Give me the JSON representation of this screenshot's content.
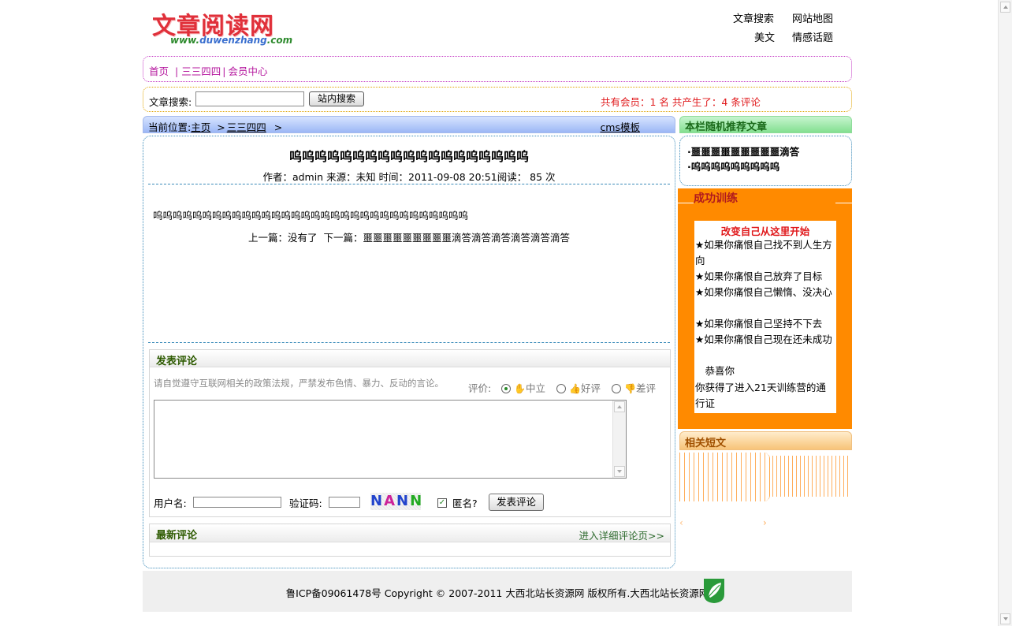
{
  "header": {
    "logo_text": "文章阅读网",
    "logo_url_prefix": "www.",
    "logo_url_domain": "duwenzhang",
    "logo_url_suffix": ".com",
    "top_links": [
      "文章搜索",
      "网站地图",
      "美文",
      "情感话题"
    ]
  },
  "nav": {
    "items": [
      "首页",
      "三三四四",
      "会员中心"
    ],
    "separator": "|"
  },
  "search": {
    "label": "文章搜索:",
    "value": "",
    "button": "站内搜索",
    "stats": "共有会员：1 名  共产生了：4 条评论"
  },
  "breadcrumb": {
    "prefix": "当前位置:",
    "home": "主页",
    "category": "三三四四",
    "arrow": ">",
    "right_link": "cms模板"
  },
  "article": {
    "title": "呜呜呜呜呜呜呜呜呜呜呜呜呜呜呜呜呜呜呜",
    "meta": "作者：admin 来源：未知 时间：2011-09-08 20:51阅读： 85 次",
    "body": "呜呜呜呜呜呜呜呜呜呜呜呜呜呜呜呜呜呜呜呜呜呜呜呜呜呜呜呜呜呜呜呜",
    "prev_label": "上一篇：没有了",
    "next_label": "下一篇：噩噩噩噩噩噩噩噩噩滴答滴答滴答滴答滴答滴答"
  },
  "comment_form": {
    "title": "发表评论",
    "notice": "请自觉遵守互联网相关的政策法规，严禁发布色情、暴力、反动的言论。",
    "rating_label": "评价:",
    "rating_options": [
      "中立",
      "好评",
      "差评"
    ],
    "rating_selected": "中立",
    "textarea_value": "",
    "username_label": "用户名:",
    "username_value": "",
    "captcha_label": "验证码:",
    "captcha_value": "",
    "captcha_text": [
      "N",
      "A",
      "N",
      "N"
    ],
    "anonymous_label": "匿名?",
    "anonymous_checked": true,
    "submit": "发表评论"
  },
  "latest_comments": {
    "title": "最新评论",
    "more_link": "进入详细评论页>>"
  },
  "sidebar": {
    "random_title": "本栏随机推荐文章",
    "random_items": [
      "·噩噩噩噩噩噩噩噩噩滴答",
      "·呜呜呜呜呜呜呜呜呜"
    ],
    "training_title": "成功训练",
    "training_heading": "改变自己从这里开始",
    "training_lines": [
      "★如果你痛恨自己找不到人生方向",
      "★如果你痛恨自己放弃了目标",
      "★如果你痛恨自己懒惰、没决心",
      "★如果你痛恨自己坚持不下去",
      "★如果你痛恨自己现在还未成功",
      "　恭喜你",
      "你获得了进入21天训练营的通行证"
    ],
    "related_title": "相关短文"
  },
  "footer": {
    "text": "鲁ICP备09061478号  Copyright © 2007-2011 大西北站长资源网  版权所有.大西北站长资源网"
  },
  "colors": {
    "nav_link": "#b5179e",
    "stat_red": "#e0181b",
    "orange_panel": "#ff8a00",
    "section_green": "#2d5a00"
  }
}
